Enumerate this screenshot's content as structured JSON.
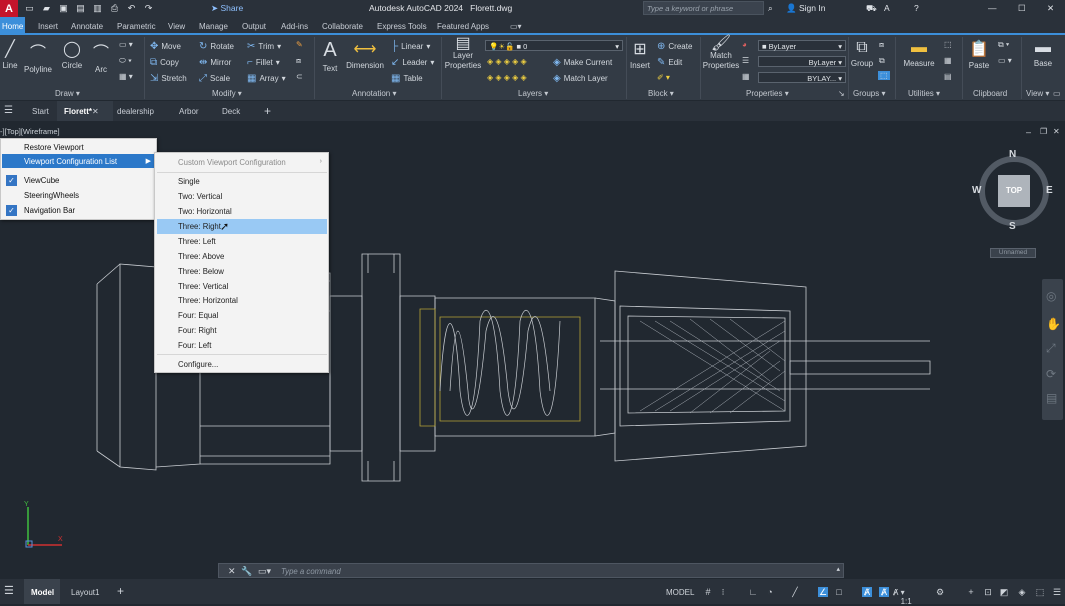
{
  "app": {
    "title": "Autodesk AutoCAD 2024",
    "file": "Florett.dwg",
    "logo": "A",
    "share": "Share",
    "search_placeholder": "Type a keyword or phrase",
    "sign_in": "Sign In"
  },
  "ribbon_tabs": [
    "Home",
    "Insert",
    "Annotate",
    "Parametric",
    "View",
    "Manage",
    "Output",
    "Add-ins",
    "Collaborate",
    "Express Tools",
    "Featured Apps"
  ],
  "ribbon": {
    "draw": {
      "line": "Line",
      "polyline": "Polyline",
      "circle": "Circle",
      "arc": "Arc",
      "panel": "Draw"
    },
    "modify": {
      "move": "Move",
      "rotate": "Rotate",
      "trim": "Trim",
      "copy": "Copy",
      "mirror": "Mirror",
      "fillet": "Fillet",
      "stretch": "Stretch",
      "scale": "Scale",
      "array": "Array",
      "panel": "Modify"
    },
    "annotation": {
      "text": "Text",
      "dimension": "Dimension",
      "linear": "Linear",
      "leader": "Leader",
      "table": "Table",
      "panel": "Annotation"
    },
    "layers": {
      "layer_properties_1": "Layer",
      "layer_properties_2": "Properties",
      "current_layer": "0",
      "make_current": "Make Current",
      "match_layer": "Match Layer",
      "panel": "Layers"
    },
    "block": {
      "insert": "Insert",
      "create": "Create",
      "edit": "Edit",
      "panel": "Block"
    },
    "properties": {
      "match_1": "Match",
      "match_2": "Properties",
      "bylayer1": "ByLayer",
      "bylayer2": "ByLayer",
      "bylayer3": "BYLAY...",
      "panel": "Properties"
    },
    "groups": {
      "group": "Group",
      "panel": "Groups"
    },
    "utilities": {
      "measure": "Measure",
      "panel": "Utilities"
    },
    "clipboard": {
      "paste": "Paste",
      "panel": "Clipboard"
    },
    "view": {
      "base": "Base",
      "panel": "View"
    }
  },
  "doc_tabs": [
    "Start",
    "Florett*",
    "dealership",
    "Arbor",
    "Deck"
  ],
  "viewport_label": "-][Top][Wireframe]",
  "context_menu": {
    "items": [
      "Restore Viewport",
      "Viewport Configuration List",
      "ViewCube",
      "SteeringWheels",
      "Navigation Bar"
    ],
    "checked": [
      false,
      false,
      true,
      false,
      true
    ]
  },
  "submenu": {
    "header": "Custom Viewport Configuration",
    "items": [
      "Single",
      "Two:  Vertical",
      "Two:  Horizontal",
      "Three:  Right",
      "Three:  Left",
      "Three:  Above",
      "Three:  Below",
      "Three:  Vertical",
      "Three:  Horizontal",
      "Four:  Equal",
      "Four:  Right",
      "Four:  Left"
    ],
    "highlighted": "Three:  Right",
    "configure": "Configure..."
  },
  "viewcube": {
    "n": "N",
    "s": "S",
    "e": "E",
    "w": "W",
    "face": "TOP",
    "wcs": "Unnamed"
  },
  "ucs": {
    "x": "X",
    "y": "Y"
  },
  "command": {
    "placeholder": "Type a command"
  },
  "status": {
    "model_tab": "Model",
    "layout_tab": "Layout1",
    "model": "MODEL",
    "scale": "1:1"
  }
}
